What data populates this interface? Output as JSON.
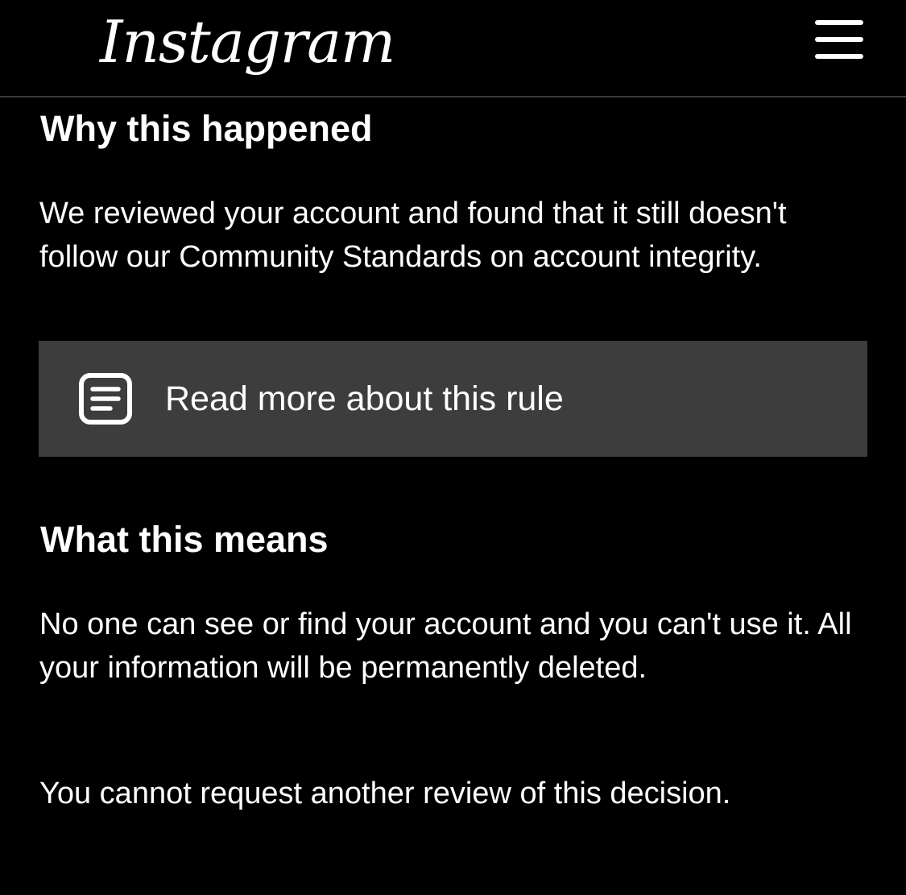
{
  "header": {
    "logo_text": "Instagram",
    "menu_icon": "hamburger-menu-icon"
  },
  "why": {
    "heading": "Why this happened",
    "body": "We reviewed your account and found that it still doesn't follow our Community Standards on account integrity."
  },
  "rule_link": {
    "icon": "document-icon",
    "label": "Read more about this rule"
  },
  "means": {
    "heading": "What this means",
    "body": "No one can see or find your account and you can't use it. All your information will be permanently deleted.",
    "note": "You cannot request another review of this decision."
  },
  "colors": {
    "background": "#000000",
    "text": "#ffffff",
    "link_background": "#3d3d3d",
    "divider": "#3a3a3a"
  }
}
